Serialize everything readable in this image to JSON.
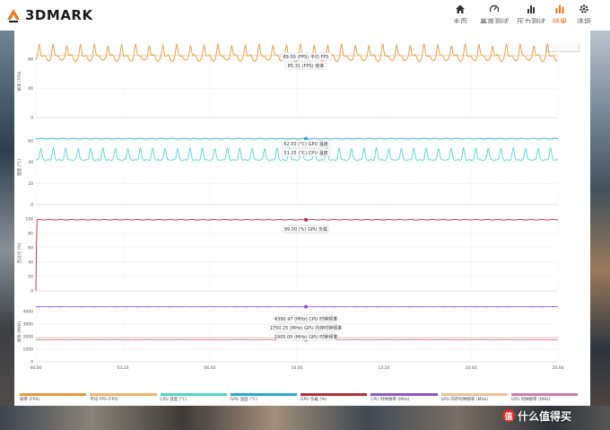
{
  "app": {
    "brand": "3DMARK"
  },
  "nav": [
    {
      "label": "主页",
      "icon": "home-icon",
      "active": false
    },
    {
      "label": "基准测试",
      "icon": "gauge-icon",
      "active": false
    },
    {
      "label": "压力测试",
      "icon": "bar-chart-icon",
      "active": false
    },
    {
      "label": "结果",
      "icon": "results-chart-icon",
      "active": true
    },
    {
      "label": "选项",
      "icon": "gear-icon",
      "active": false
    }
  ],
  "colors": {
    "accent": "#e8771e",
    "fps": "#e09a3b",
    "fps_avg": "#f0b36a",
    "cpu_temp": "#4fd6c9",
    "gpu_temp": "#2aa9cf",
    "gpu_load": "#b3303c",
    "cpu_clock": "#8b57c4",
    "gpu_mem_clock": "#e6c49a",
    "gpu_clock": "#d07ab0"
  },
  "watermark": {
    "badge": "值",
    "text": "什么值得买"
  },
  "chart_data": {
    "type": "line",
    "x_ticks": [
      "00:00",
      "03:20",
      "06:40",
      "10:00",
      "13:20",
      "16:40",
      "20:00"
    ],
    "x_range_seconds": [
      0,
      1200
    ],
    "panels": [
      {
        "ylabel": "帧率 (FPS)",
        "yticks": [
          0,
          40,
          80
        ],
        "ylim": [
          0,
          100
        ],
        "series": [
          {
            "name": "帧率 (FPS)",
            "color": "#e09a3b",
            "mean": 85.3,
            "min": 72,
            "max": 100,
            "pattern": "oscillating"
          }
        ],
        "tooltips": [
          "89.00 (FPS) 平均 FPS",
          "85.31 (FPS) 帧率"
        ]
      },
      {
        "ylabel": "温度 (°C)",
        "yticks": [
          0,
          20,
          40,
          60
        ],
        "ylim": [
          0,
          70
        ],
        "series": [
          {
            "name": "CPU 温度 (°C)",
            "color": "#4fd6c9",
            "mean": 47,
            "min": 42,
            "max": 53,
            "pattern": "spiky"
          },
          {
            "name": "GPU 温度 (°C)",
            "color": "#2aa9cf",
            "mean": 62,
            "min": 60,
            "max": 64,
            "pattern": "flat"
          }
        ],
        "tooltips": [
          "62.00 (°C) GPU 温度",
          "51.25 (°C) CPU 温度"
        ]
      },
      {
        "ylabel": "百分比 (%)",
        "yticks": [
          0,
          20,
          40,
          60,
          80,
          100
        ],
        "ylim": [
          0,
          105
        ],
        "series": [
          {
            "name": "GPU 负载 (%)",
            "color": "#b3303c",
            "mean": 99,
            "min": 96,
            "max": 100,
            "pattern": "flat"
          }
        ],
        "tooltips": [
          "99.00 (%) GPU 负载"
        ]
      },
      {
        "ylabel": "频率 (MHz)",
        "yticks": [
          0,
          1000,
          2000,
          3000,
          4000
        ],
        "ylim": [
          0,
          4800
        ],
        "series": [
          {
            "name": "CPU 时钟频率 (MHz)",
            "color": "#8b57c4",
            "mean": 4390,
            "min": 4380,
            "max": 4400,
            "pattern": "flat"
          },
          {
            "name": "GPU 内存时钟频率 (MHz)",
            "color": "#e6c49a",
            "mean": 1905,
            "min": 1900,
            "max": 1910,
            "pattern": "flat"
          },
          {
            "name": "GPU 时钟频率 (MHz)",
            "color": "#d07ab0",
            "mean": 1750,
            "min": 1700,
            "max": 1800,
            "pattern": "flat"
          }
        ],
        "tooltips": [
          "4390.97 (MHz) CPU 时钟频率",
          "1750.25 (MHz) GPU 内存时钟频率",
          "1905.00 (MHz) GPU 时钟频率"
        ]
      }
    ],
    "legend": [
      {
        "label": "帧率 (FPS)",
        "color": "#e09a3b"
      },
      {
        "label": "平均 FPS (FPS)",
        "color": "#f0b36a"
      },
      {
        "label": "CPU 温度 (°C)",
        "color": "#4fd6c9"
      },
      {
        "label": "GPU 温度 (°C)",
        "color": "#2aa9cf"
      },
      {
        "label": "GPU 负载 (%)",
        "color": "#b3303c"
      },
      {
        "label": "CPU 时钟频率 (MHz)",
        "color": "#8b57c4"
      },
      {
        "label": "GPU 内存时钟频率 (MHz)",
        "color": "#e6c49a"
      },
      {
        "label": "GPU 时钟频率 (MHz)",
        "color": "#d07ab0"
      }
    ],
    "legend_position": "bottom",
    "grid": true
  }
}
